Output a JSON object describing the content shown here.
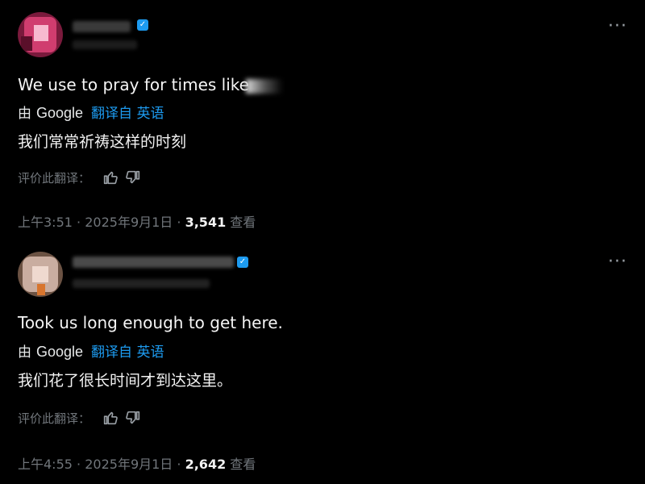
{
  "posts": [
    {
      "text_visible": "We use to pray for times like",
      "translated_by": "由",
      "google": "Google",
      "translate_link": "翻译自 英语",
      "translation": "我们常常祈祷这样的时刻",
      "rate_label": "评价此翻译：",
      "time": "上午3:51",
      "date": "2025年9月1日",
      "views_count": "3,541",
      "views_label": "查看",
      "sep": "·",
      "more": "···"
    },
    {
      "text_visible": "Took us long enough to get here.",
      "translated_by": "由",
      "google": "Google",
      "translate_link": "翻译自 英语",
      "translation": "我们花了很长时间才到达这里。",
      "rate_label": "评价此翻译：",
      "time": "上午4:55",
      "date": "2025年9月1日",
      "views_count": "2,642",
      "views_label": "查看",
      "sep": "·",
      "more": "···"
    }
  ],
  "colors": {
    "background": "#000000",
    "text": "#e7e9ea",
    "muted": "#71767b",
    "link": "#1d9bf0",
    "verified": "#1d9bf0"
  },
  "icons": [
    "avatar",
    "verified-badge-icon",
    "more-icon",
    "thumbs-up-icon",
    "thumbs-down-icon"
  ]
}
